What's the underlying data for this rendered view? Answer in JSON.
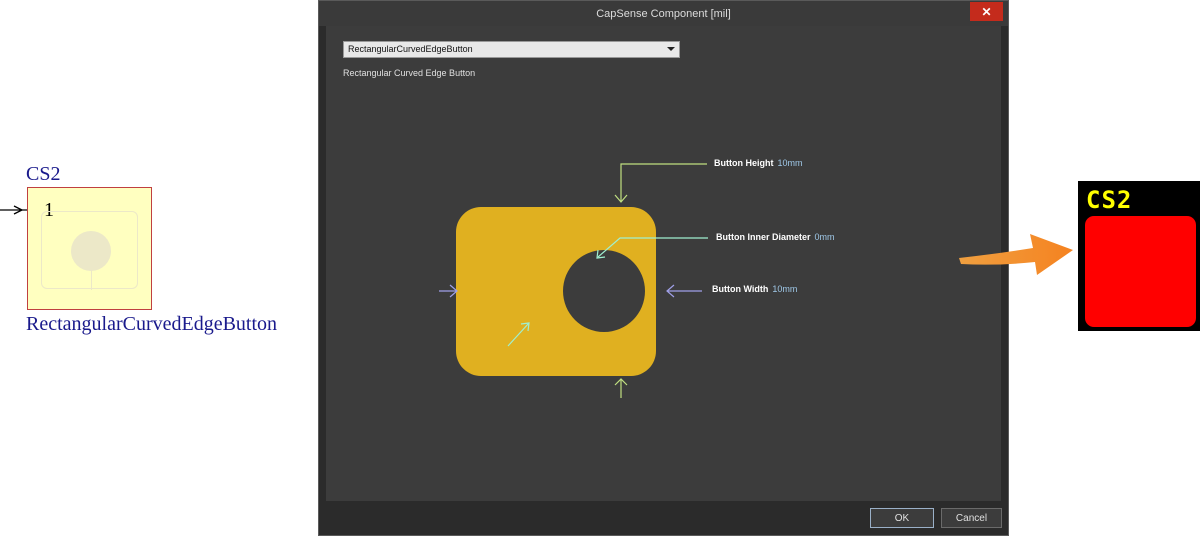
{
  "schematic": {
    "designator": "CS2",
    "pin_number": "1",
    "comment": "RectangularCurvedEdgeButton"
  },
  "dialog": {
    "title": "CapSense Component [mil]",
    "close_label": "✕",
    "type_select": {
      "value": "RectangularCurvedEdgeButton"
    },
    "type_label": "Rectangular Curved Edge Button",
    "params": {
      "button_height": {
        "label": "Button Height",
        "value": "10mm"
      },
      "button_inner_diameter": {
        "label": "Button Inner Diameter",
        "value": "0mm"
      },
      "button_width": {
        "label": "Button Width",
        "value": "10mm"
      }
    },
    "ok_label": "OK",
    "cancel_label": "Cancel"
  },
  "pcb_preview": {
    "designator": "CS2"
  },
  "colors": {
    "button_fill": "#e0b020",
    "height_arrow": "#c0e080",
    "diameter_arrow": "#a0f0d0",
    "width_arrow": "#a0a0e8",
    "pcb_pad": "#ff0000",
    "pcb_text": "#ffff00",
    "callout_arrow": "#f58220"
  }
}
